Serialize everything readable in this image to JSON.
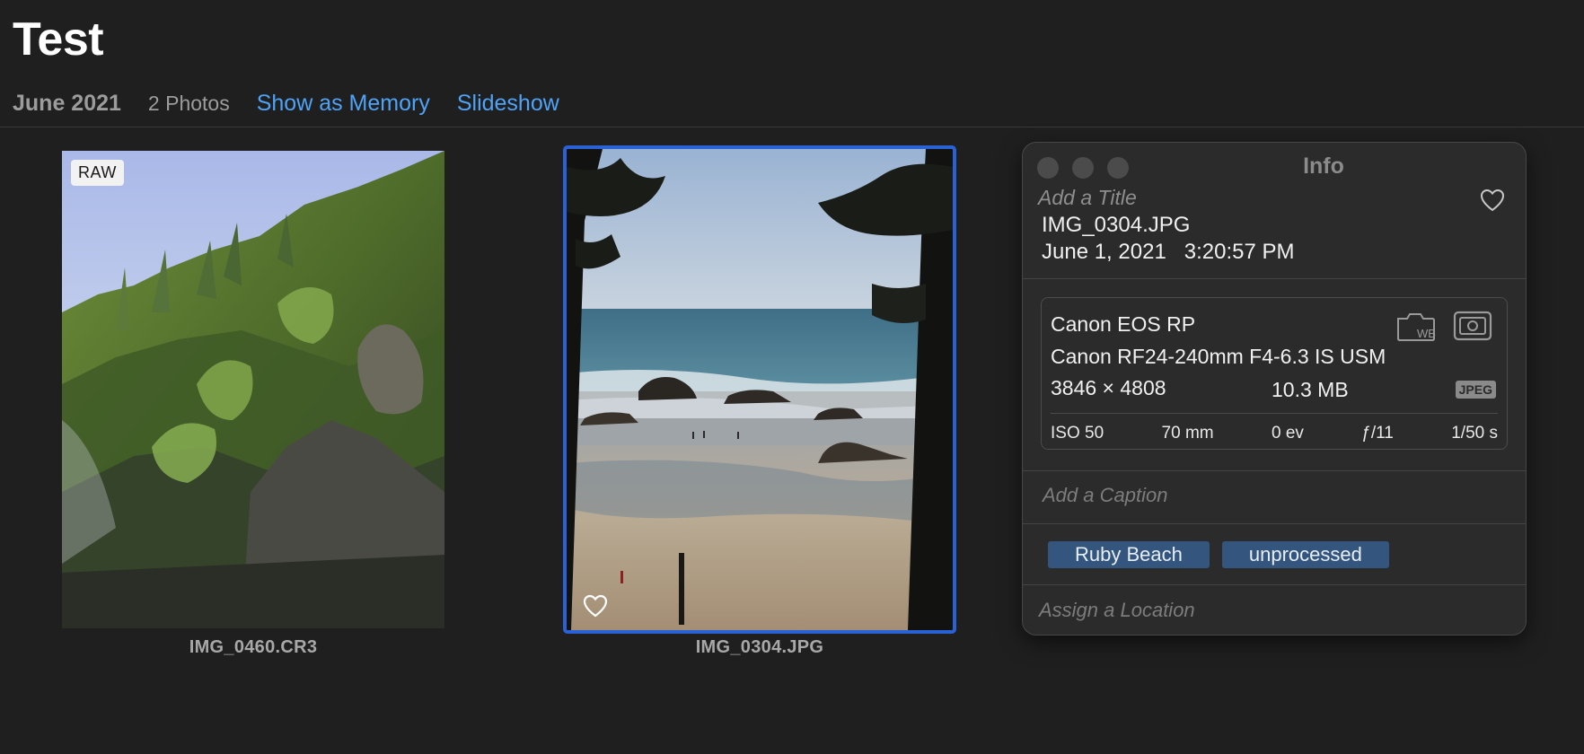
{
  "header": {
    "album_title": "Test",
    "date": "June 2021",
    "photo_count": "2 Photos",
    "show_as_memory": "Show as Memory",
    "slideshow": "Slideshow"
  },
  "photos": [
    {
      "filename": "IMG_0460.CR3",
      "badge": "RAW",
      "selected": false,
      "favorite_visible": false
    },
    {
      "filename": "IMG_0304.JPG",
      "badge": "",
      "selected": true,
      "favorite_visible": true
    }
  ],
  "info_panel": {
    "title": "Info",
    "add_title_placeholder": "Add a Title",
    "filename": "IMG_0304.JPG",
    "datetime": "June 1, 2021   3:20:57 PM",
    "camera": {
      "model": "Canon EOS RP",
      "lens": "Canon RF24-240mm F4-6.3 IS USM",
      "dimensions": "3846 × 4808",
      "file_size": "10.3 MB",
      "format_badge": "JPEG",
      "wb_label": "WB",
      "iso": "ISO 50",
      "focal_length": "70 mm",
      "exposure_bias": "0 ev",
      "aperture": "ƒ/11",
      "shutter": "1/50 s"
    },
    "add_caption_placeholder": "Add a Caption",
    "keywords": [
      "Ruby Beach",
      "unprocessed"
    ],
    "assign_location_placeholder": "Assign a Location"
  },
  "colors": {
    "background": "#1f1f1f",
    "accent_link": "#4fa3f7",
    "selection_border": "#2a62d6",
    "keyword_bg": "#34557d",
    "panel_bg": "#2b2b2b"
  },
  "icons": [
    "heart-icon",
    "camera-wb-icon",
    "metering-icon"
  ]
}
